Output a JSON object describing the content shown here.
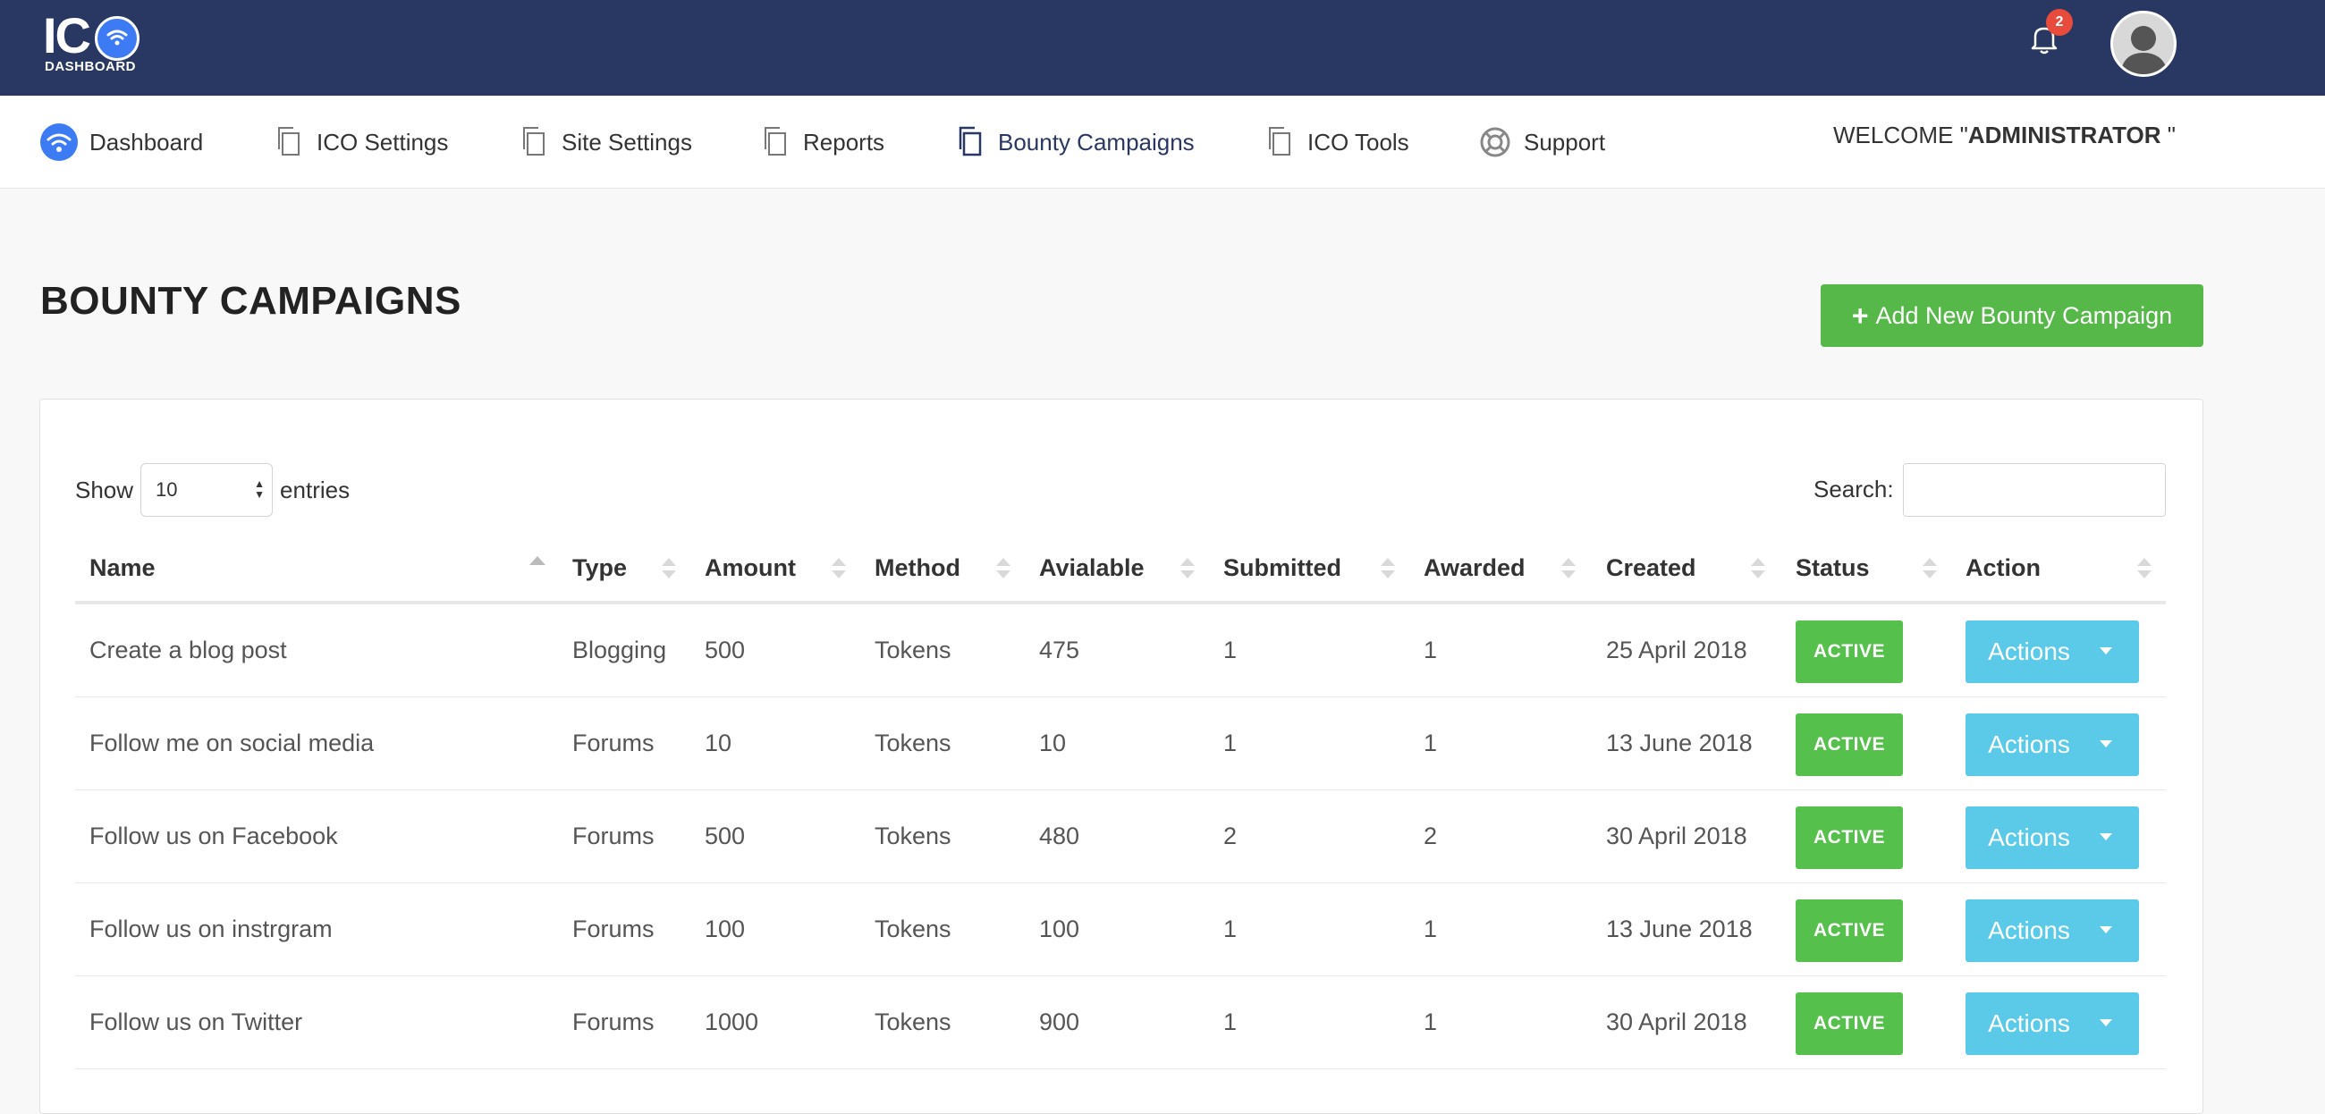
{
  "logo": {
    "mark": "IC",
    "sub": "DASHBOARD"
  },
  "header": {
    "notification_count": "2"
  },
  "nav": {
    "items": [
      {
        "label": "Dashboard",
        "icon": "wifi-circle-icon"
      },
      {
        "label": "ICO Settings",
        "icon": "copy-icon"
      },
      {
        "label": "Site Settings",
        "icon": "copy-icon"
      },
      {
        "label": "Reports",
        "icon": "copy-icon"
      },
      {
        "label": "Bounty Campaigns",
        "icon": "copy-icon"
      },
      {
        "label": "ICO Tools",
        "icon": "copy-icon"
      },
      {
        "label": "Support",
        "icon": "lifebuoy-icon"
      }
    ],
    "welcome_prefix": "WELCOME \"",
    "welcome_user": "ADMINISTRATOR",
    "welcome_suffix": " \""
  },
  "page": {
    "title": "BOUNTY CAMPAIGNS",
    "add_button_plus": "+",
    "add_button_label": "Add New Bounty Campaign"
  },
  "table_controls": {
    "show_label": "Show",
    "entries_value": "10",
    "entries_label": "entries",
    "search_label": "Search:",
    "search_value": ""
  },
  "table": {
    "columns": [
      "Name",
      "Type",
      "Amount",
      "Method",
      "Avialable",
      "Submitted",
      "Awarded",
      "Created",
      "Status",
      "Action"
    ],
    "rows": [
      {
        "name": "Create a blog post",
        "type": "Blogging",
        "amount": "500",
        "method": "Tokens",
        "available": "475",
        "submitted": "1",
        "awarded": "1",
        "created": "25 April 2018",
        "status": "ACTIVE",
        "action": "Actions"
      },
      {
        "name": "Follow me on social media",
        "type": "Forums",
        "amount": "10",
        "method": "Tokens",
        "available": "10",
        "submitted": "1",
        "awarded": "1",
        "created": "13 June 2018",
        "status": "ACTIVE",
        "action": "Actions"
      },
      {
        "name": "Follow us on Facebook",
        "type": "Forums",
        "amount": "500",
        "method": "Tokens",
        "available": "480",
        "submitted": "2",
        "awarded": "2",
        "created": "30 April 2018",
        "status": "ACTIVE",
        "action": "Actions"
      },
      {
        "name": "Follow us on instrgram",
        "type": "Forums",
        "amount": "100",
        "method": "Tokens",
        "available": "100",
        "submitted": "1",
        "awarded": "1",
        "created": "13 June 2018",
        "status": "ACTIVE",
        "action": "Actions"
      },
      {
        "name": "Follow us on Twitter",
        "type": "Forums",
        "amount": "1000",
        "method": "Tokens",
        "available": "900",
        "submitted": "1",
        "awarded": "1",
        "created": "30 April 2018",
        "status": "ACTIVE",
        "action": "Actions"
      }
    ]
  },
  "colors": {
    "header_bg": "#293862",
    "add_button": "#55b849",
    "status_active": "#55c14c",
    "actions_button": "#5bc9e8",
    "badge": "#e84b3c"
  }
}
